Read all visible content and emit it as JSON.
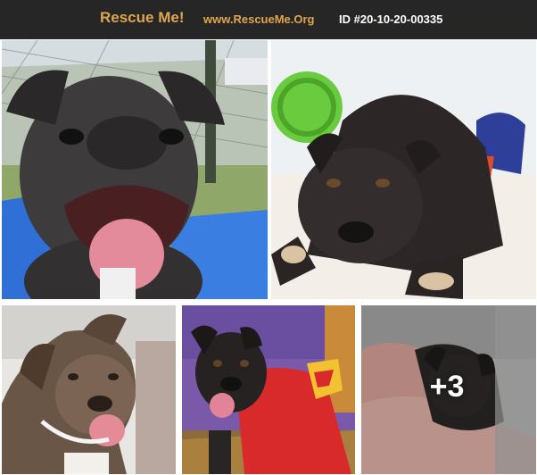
{
  "header": {
    "brand": "Rescue Me!",
    "site": "www.RescueMe.Org",
    "id_text": "ID #20-10-20-00335"
  },
  "gallery": {
    "more_count_label": "+3"
  },
  "colors": {
    "header_bg": "#262626",
    "brand": "#e0a64e",
    "id_text": "#ffffff"
  }
}
